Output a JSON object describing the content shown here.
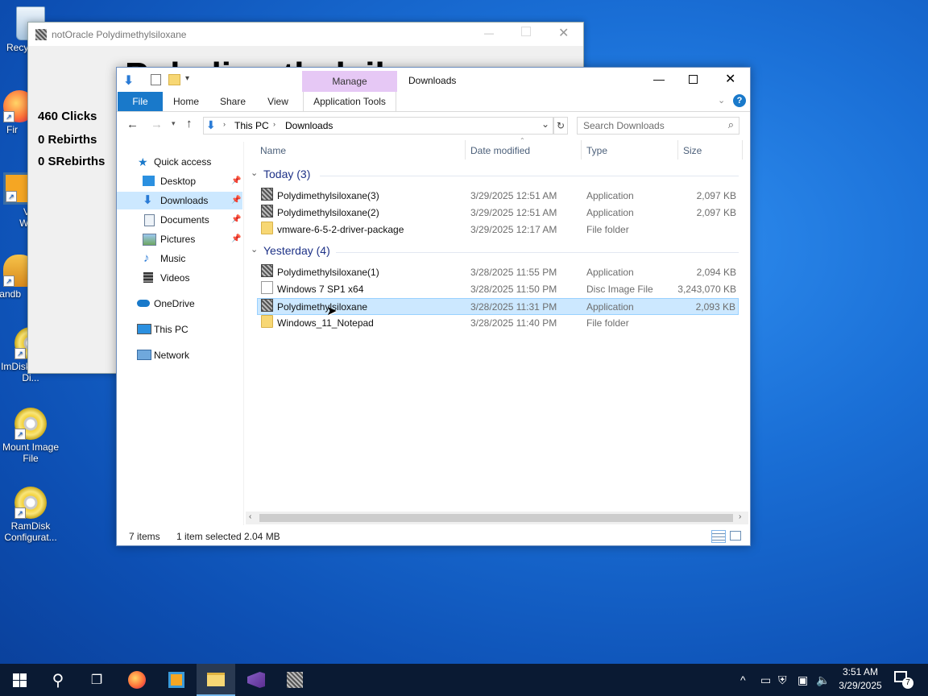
{
  "desktop": {
    "icons": [
      {
        "label": "Recy"
      },
      {
        "label": "Fir"
      },
      {
        "label": "VM Work"
      },
      {
        "label": "Sandb"
      },
      {
        "label": "ImDisk Virtual Di..."
      },
      {
        "label": "Mount Image File"
      },
      {
        "label": "RamDisk Configurat..."
      }
    ]
  },
  "bg_window": {
    "title": "notOracle Polydimethylsiloxane",
    "heading": "Polydimethylsiloxane",
    "clicks": "460 Clicks",
    "rebirths": "0 Rebirths",
    "srebirths": "0 SRebirths"
  },
  "explorer": {
    "title": "Downloads",
    "manage_label": "Manage",
    "tabs": {
      "file": "File",
      "home": "Home",
      "share": "Share",
      "view": "View",
      "app_tools": "Application Tools"
    },
    "breadcrumb": [
      "This PC",
      "Downloads"
    ],
    "search_placeholder": "Search Downloads",
    "sidebar": [
      {
        "label": "Quick access"
      },
      {
        "label": "Desktop"
      },
      {
        "label": "Downloads"
      },
      {
        "label": "Documents"
      },
      {
        "label": "Pictures"
      },
      {
        "label": "Music"
      },
      {
        "label": "Videos"
      },
      {
        "label": "OneDrive"
      },
      {
        "label": "This PC"
      },
      {
        "label": "Network"
      }
    ],
    "columns": {
      "name": "Name",
      "date": "Date modified",
      "type": "Type",
      "size": "Size"
    },
    "groups": [
      {
        "label": "Today (3)",
        "files": [
          {
            "name": "Polydimethylsiloxane(3)",
            "date": "3/29/2025 12:51 AM",
            "type": "Application",
            "size": "2,097 KB"
          },
          {
            "name": "Polydimethylsiloxane(2)",
            "date": "3/29/2025 12:51 AM",
            "type": "Application",
            "size": "2,097 KB"
          },
          {
            "name": "vmware-6-5-2-driver-package",
            "date": "3/29/2025 12:17 AM",
            "type": "File folder",
            "size": ""
          }
        ]
      },
      {
        "label": "Yesterday (4)",
        "files": [
          {
            "name": "Polydimethylsiloxane(1)",
            "date": "3/28/2025 11:55 PM",
            "type": "Application",
            "size": "2,094 KB"
          },
          {
            "name": "Windows 7 SP1 x64",
            "date": "3/28/2025 11:50 PM",
            "type": "Disc Image File",
            "size": "3,243,070 KB"
          },
          {
            "name": "Polydimethylsiloxane",
            "date": "3/28/2025 11:31 PM",
            "type": "Application",
            "size": "2,093 KB"
          },
          {
            "name": "Windows_11_Notepad",
            "date": "3/28/2025 11:40 PM",
            "type": "File folder",
            "size": ""
          }
        ]
      }
    ],
    "status": {
      "items": "7 items",
      "selected": "1 item selected",
      "size": "2.04 MB"
    }
  },
  "taskbar": {
    "time": "3:51 AM",
    "date": "3/29/2025",
    "notification_count": "7"
  },
  "colors": {
    "accent": "#0063b1",
    "selection": "#cce8ff",
    "manage_tab": "#e6c8f5"
  }
}
